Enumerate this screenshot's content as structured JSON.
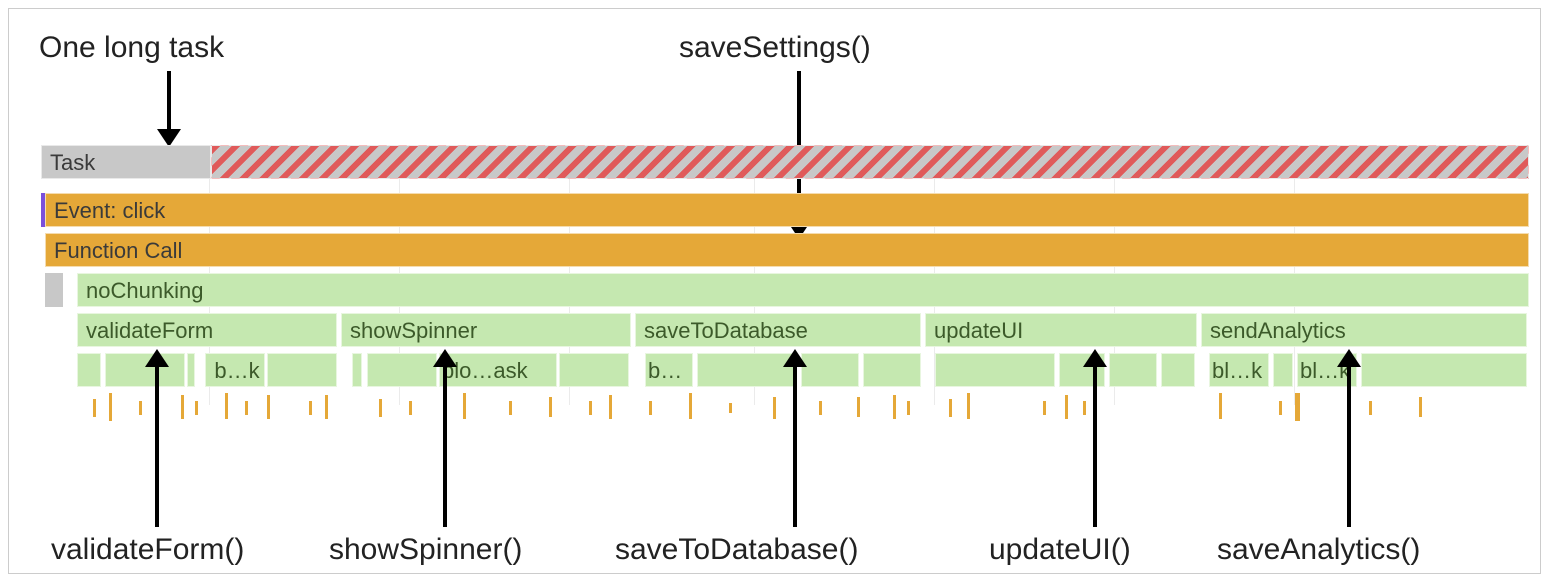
{
  "annotations": {
    "top_left": "One long task",
    "top_right": "saveSettings()",
    "bottom": {
      "validateForm": "validateForm()",
      "showSpinner": "showSpinner()",
      "saveToDatabase": "saveToDatabase()",
      "updateUI": "updateUI()",
      "saveAnalytics": "saveAnalytics()"
    }
  },
  "rows": {
    "task": {
      "label": "Task"
    },
    "event": {
      "label": "Event: click"
    },
    "functionCall": {
      "label": "Function Call"
    },
    "noChunking": {
      "label": "noChunking"
    },
    "children": {
      "validateForm": "validateForm",
      "showSpinner": "showSpinner",
      "saveToDatabase": "saveToDatabase",
      "updateUI": "updateUI",
      "sendAnalytics": "sendAnalytics"
    },
    "blocks": {
      "b1": "b…k",
      "b2": "blo…ask",
      "b3": "b…",
      "b4": "bl…k",
      "b5": "bl…k"
    }
  },
  "colors": {
    "taskGray": "#c8c8c8",
    "longTaskStripe": "#e05a5a",
    "eventOrange": "#e5a838",
    "callGreen": "#c5e8b0"
  }
}
